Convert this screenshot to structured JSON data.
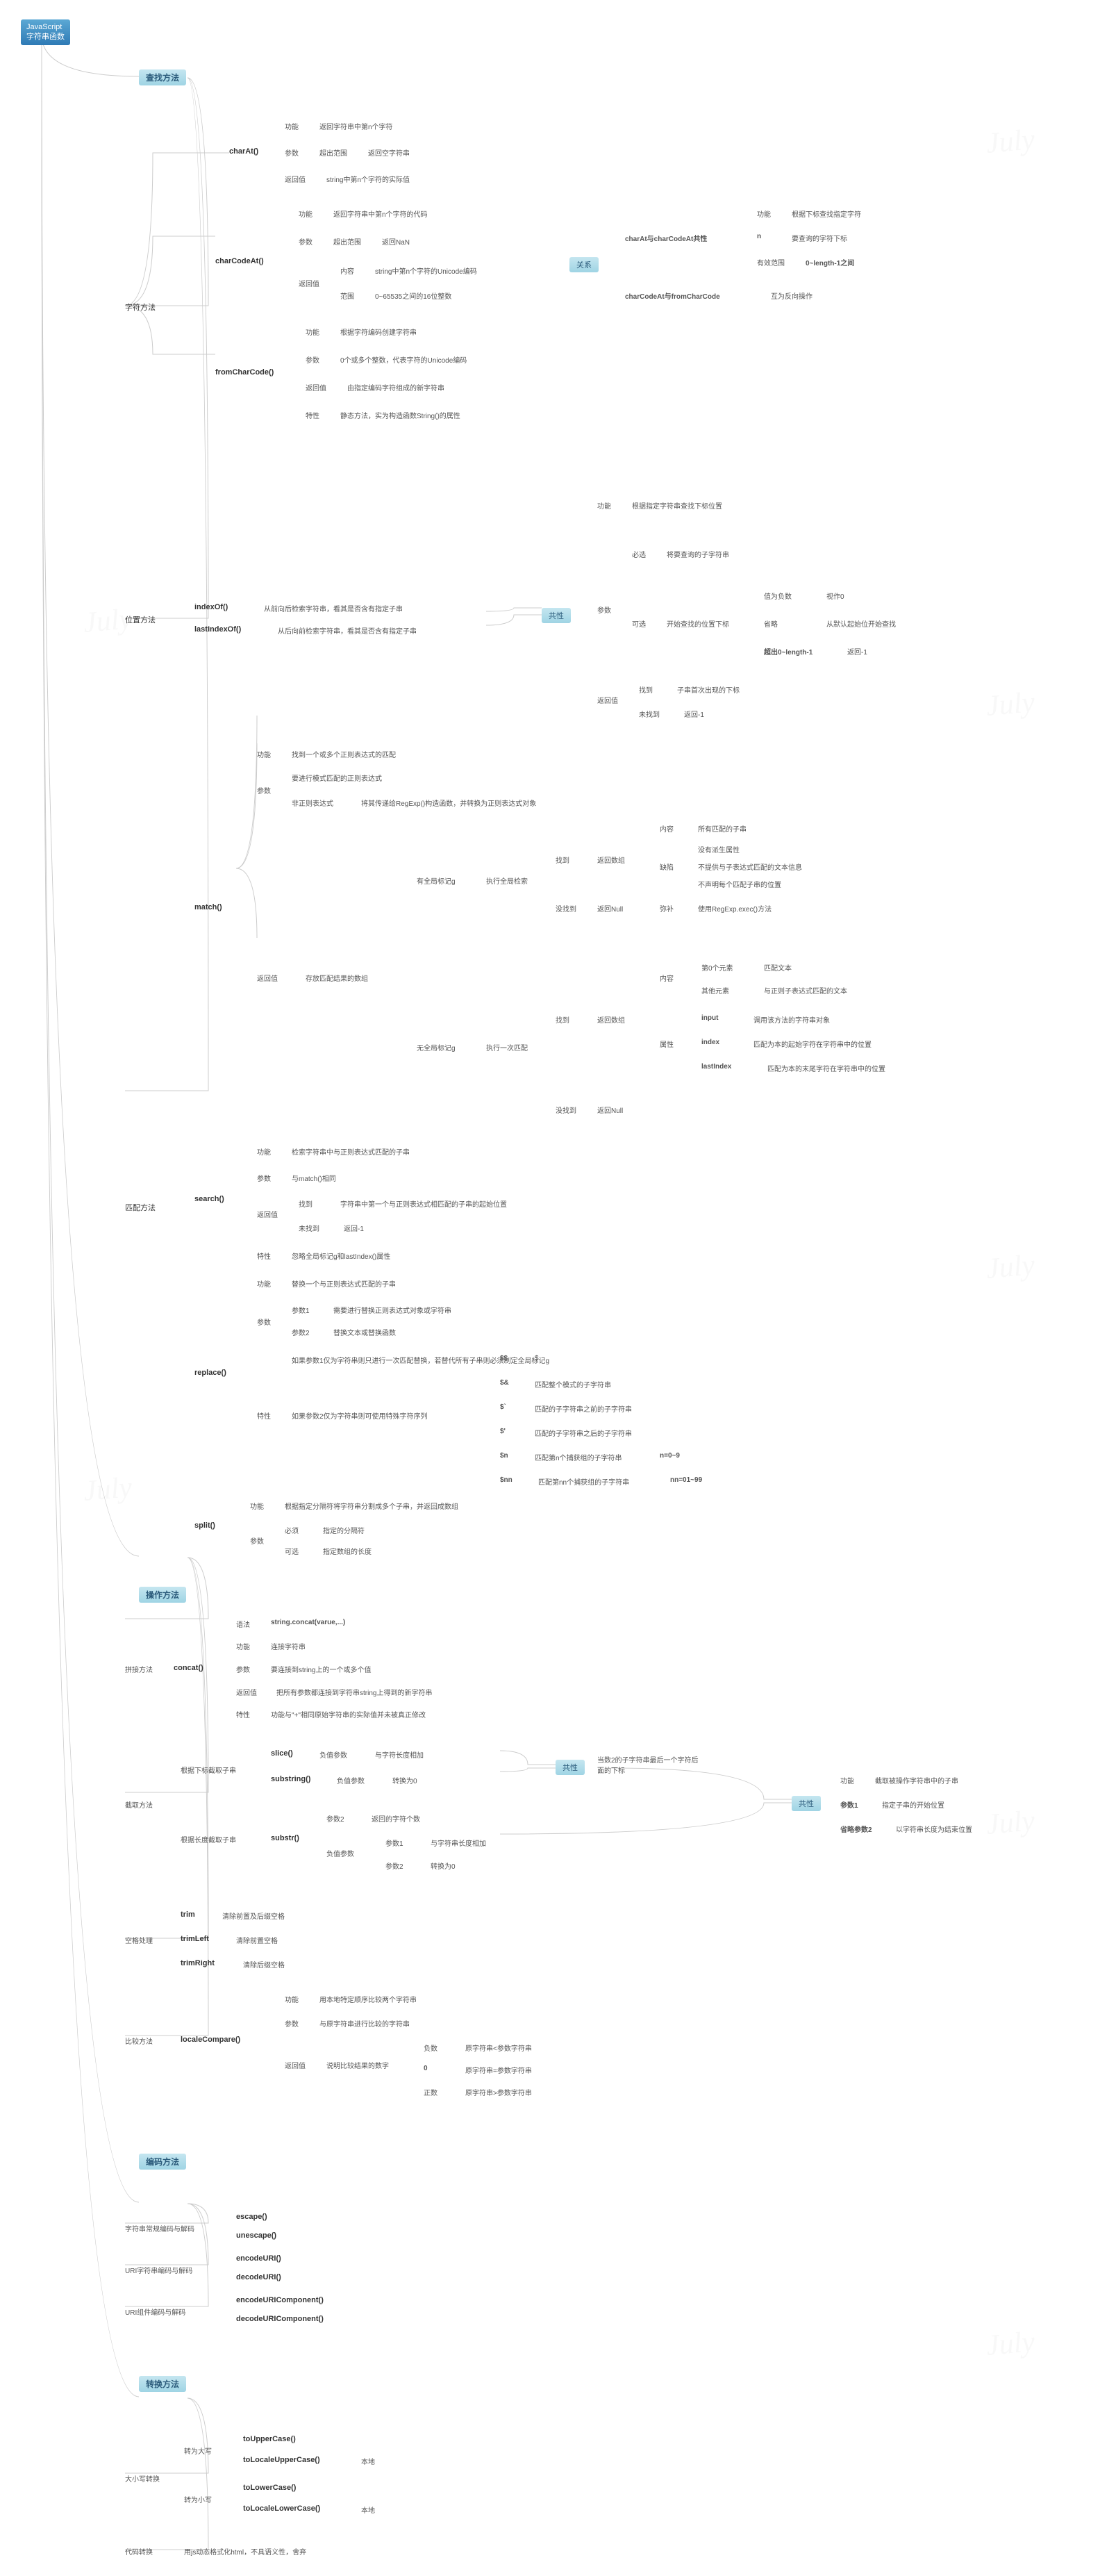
{
  "root": {
    "line1": "JavaScript",
    "line2": "字符串函数"
  },
  "s1": {
    "title": "查找方法",
    "char_method": "字符方法",
    "charAt": {
      "name": "charAt()",
      "fn": "功能",
      "fn_v": "返回字符串中第n个字符",
      "param": "参数",
      "param_ov": "超出范围",
      "param_ov_v": "返回空字符串",
      "ret": "返回值",
      "ret_v": "string中第n个字符的实际值"
    },
    "charCodeAt": {
      "name": "charCodeAt()",
      "fn": "功能",
      "fn_v": "返回字符串中第n个字符的代码",
      "param": "参数",
      "param_ov": "超出范围",
      "param_ov_v": "返回NaN",
      "ret": "返回值",
      "ret_c": "内容",
      "ret_c_v": "string中第n个字符的Unicode编码",
      "ret_r": "范围",
      "ret_r_v": "0~65535之间的16位整数"
    },
    "fromCharCode": {
      "name": "fromCharCode()",
      "fn": "功能",
      "fn_v": "根据字符编码创建字符串",
      "param": "参数",
      "param_v": "0个或多个整数，代表字符的Unicode编码",
      "ret": "返回值",
      "ret_v": "由指定编码字符组成的新字符串",
      "spec": "特性",
      "spec_v": "静态方法，实为构造函数String()的属性"
    },
    "rel": {
      "title": "关系",
      "ab": "charAt与charCodeAt共性",
      "ab_fn": "功能",
      "ab_fn_v": "根据下标查找指定字符",
      "ab_n": "n",
      "ab_n_v": "要查询的字符下标",
      "ab_valid": "有效范围",
      "ab_valid_v": "0~length-1之间",
      "bc": "charCodeAt与fromCharCode",
      "bc_v": "互为反向操作"
    },
    "pos_method": "位置方法",
    "indexOf": "indexOf()",
    "indexOf_v": "从前向后检索字符串，看其是否含有指定子串",
    "lastIndexOf": "lastIndexOf()",
    "lastIndexOf_v": "从后向前检索字符串，看其是否含有指定子串",
    "pos_shared": {
      "title": "共性",
      "fn": "功能",
      "fn_v": "根据指定字符串查找下标位置",
      "param": "参数",
      "req": "必选",
      "req_v": "将要查询的子字符串",
      "opt": "可选",
      "opt_v": "开始查找的位置下标",
      "opt_neg": "值为负数",
      "opt_neg_v": "视作0",
      "opt_omit": "省略",
      "opt_omit_v": "从默认起始位开始查找",
      "opt_over": "超出0~length-1",
      "opt_over_v": "返回-1",
      "ret": "返回值",
      "found": "找到",
      "found_v": "子串首次出现的下标",
      "nfound": "未找到",
      "nfound_v": "返回-1"
    },
    "match_method": "匹配方法",
    "match": {
      "name": "match()",
      "fn": "功能",
      "fn_v": "找到一个或多个正则表达式的匹配",
      "param": "参数",
      "p1": "要进行模式匹配的正则表达式",
      "p2": "非正则表达式",
      "p2_v": "将其传递给RegExp()构造函数，并转换为正则表达式对象",
      "ret": "返回值",
      "ret_v": "存放匹配结果的数组",
      "g": "有全局标记g",
      "g_v": "执行全局检索",
      "g_found": "找到",
      "g_found_v": "返回数组",
      "g_nfound": "没找到",
      "g_nfound_v": "返回Null",
      "g_content": "内容",
      "g_content_v": "所有匹配的子串",
      "g_miss": "缺陷",
      "g_miss1": "没有派生属性",
      "g_miss2": "不提供与子表达式匹配的文本信息",
      "g_miss3": "不声明每个匹配子串的位置",
      "g_fix": "弥补",
      "g_fix_v": "使用RegExp.exec()方法",
      "ng": "无全局标记g",
      "ng_v": "执行一次匹配",
      "ng_found": "找到",
      "ng_found_v": "返回数组",
      "ng_nfound": "没找到",
      "ng_nfound_v": "返回Null",
      "ng_content": "内容",
      "ng_e0": "第0个元素",
      "ng_e0_v": "匹配文本",
      "ng_eo": "其他元素",
      "ng_eo_v": "与正则子表达式匹配的文本",
      "ng_attr": "属性",
      "ng_input": "input",
      "ng_input_v": "调用该方法的字符串对象",
      "ng_index": "index",
      "ng_index_v": "匹配为本的起始字符在字符串中的位置",
      "ng_lastIndex": "lastIndex",
      "ng_lastIndex_v": "匹配为本的末尾字符在字符串中的位置"
    },
    "search": {
      "name": "search()",
      "fn": "功能",
      "fn_v": "检索字符串中与正则表达式匹配的子串",
      "param": "参数",
      "param_v": "与match()相同",
      "ret": "返回值",
      "found": "找到",
      "found_v": "字符串中第一个与正则表达式相匹配的子串的起始位置",
      "nfound": "未找到",
      "nfound_v": "返回-1",
      "spec": "特性",
      "spec_v": "忽略全局标记g和lastIndex()属性"
    },
    "replace": {
      "name": "replace()",
      "fn": "功能",
      "fn_v": "替换一个与正则表达式匹配的子串",
      "param": "参数",
      "p1": "参数1",
      "p1_v": "需要进行替换正则表达式对象或字符串",
      "p2": "参数2",
      "p2_v": "替换文本或替换函数",
      "spec": "特性",
      "t1": "如果参数1仅为字符串则只进行一次匹配替换，若替代所有子串则必须制定全局标记g",
      "t2": "如果参数2仅为字符串则可使用特殊字符序列",
      "ss": "$$",
      "ss_v": "$",
      "sa": "$&",
      "sa_v": "匹配整个模式的子字符串",
      "sb": "$`",
      "sb_v": "匹配的子字符串之前的子字符串",
      "sq": "$'",
      "sq_v": "匹配的子字符串之后的子字符串",
      "sn": "$n",
      "sn_v": "匹配第n个捕获组的子字符串",
      "sn_r": "n=0~9",
      "snn": "$nn",
      "snn_v": "匹配第nn个捕获组的子字符串",
      "snn_r": "nn=01~99"
    },
    "split": {
      "name": "split()",
      "fn": "功能",
      "fn_v": "根据指定分隔符将字符串分割成多个子串，并返回成数组",
      "param": "参数",
      "req": "必须",
      "req_v": "指定的分隔符",
      "opt": "可选",
      "opt_v": "指定数组的长度"
    }
  },
  "s2": {
    "title": "操作方法",
    "concat_group": "拼接方法",
    "concat": {
      "name": "concat()",
      "syntax": "语法",
      "syntax_v": "string.concat(varue,...)",
      "fn": "功能",
      "fn_v": "连接字符串",
      "param": "参数",
      "param_v": "要连接到string上的一个或多个值",
      "ret": "返回值",
      "ret_v": "把所有参数都连接到字符串string上得到的新字符串",
      "spec": "特性",
      "spec_v": "功能与\"+\"相同原始字符串的实际值并未被真正修改"
    },
    "cut_group": "截取方法",
    "cut_idx": "根据下标截取子串",
    "cut_len": "根据长度截取子串",
    "slice": "slice()",
    "slice_neg": "负值参数",
    "slice_neg_v": "与字符长度相加",
    "substring": "substring()",
    "substring_neg": "负值参数",
    "substring_neg_v": "转换为0",
    "substr": "substr()",
    "substr_p2": "参数2",
    "substr_p2_v": "返回的字符个数",
    "substr_neg": "负值参数",
    "substr_neg1": "参数1",
    "substr_neg1_v": "与字符串长度相加",
    "substr_neg2": "参数2",
    "substr_neg2_v": "转换为0",
    "cut_shared1": {
      "title": "共性",
      "note": "当数2的子字符串最后一个字符后面的下标"
    },
    "cut_shared2": {
      "title": "共性",
      "fn": "功能",
      "fn_v": "截取被操作字符串中的子串",
      "p1": "参数1",
      "p1_v": "指定子串的开始位置",
      "p2": "省略参数2",
      "p2_v": "以字符串长度为结束位置"
    },
    "trim_group": "空格处理",
    "trim": "trim",
    "trim_v": "清除前置及后缀空格",
    "trimLeft": "trimLeft",
    "trimLeft_v": "清除前置空格",
    "trimRight": "trimRight",
    "trimRight_v": "清除后缀空格",
    "cmp_group": "比较方法",
    "localeCompare": {
      "name": "localeCompare()",
      "fn": "功能",
      "fn_v": "用本地特定顺序比较两个字符串",
      "param": "参数",
      "param_v": "与原字符串进行比较的字符串",
      "ret": "返回值",
      "ret_v": "说明比较结果的数字",
      "neg": "负数",
      "neg_v": "原字符串<参数字符串",
      "zero": "0",
      "zero_v": "原字符串=参数字符串",
      "pos": "正数",
      "pos_v": "原字符串>参数字符串"
    }
  },
  "s3": {
    "title": "编码方法",
    "g1": "字符串常规编码与解码",
    "escape": "escape()",
    "unescape": "unescape()",
    "g2": "URI字符串编码与解码",
    "encodeURI": "encodeURI()",
    "decodeURI": "decodeURI()",
    "g3": "URI组件编码与解码",
    "encodeURIComponent": "encodeURIComponent()",
    "decodeURIComponent": "decodeURIComponent()"
  },
  "s4": {
    "title": "转换方法",
    "case_group": "大小写转换",
    "up": "转为大写",
    "toUpperCase": "toUpperCase()",
    "toLocaleUpperCase": "toLocaleUpperCase()",
    "locale1": "本地",
    "low": "转为小写",
    "toLowerCase": "toLowerCase()",
    "toLocaleLowerCase": "toLocaleLowerCase()",
    "locale2": "本地",
    "code_group": "代码转换",
    "code_v": "用js动态格式化html，不具语义性，舍弃"
  },
  "watermark": "July"
}
